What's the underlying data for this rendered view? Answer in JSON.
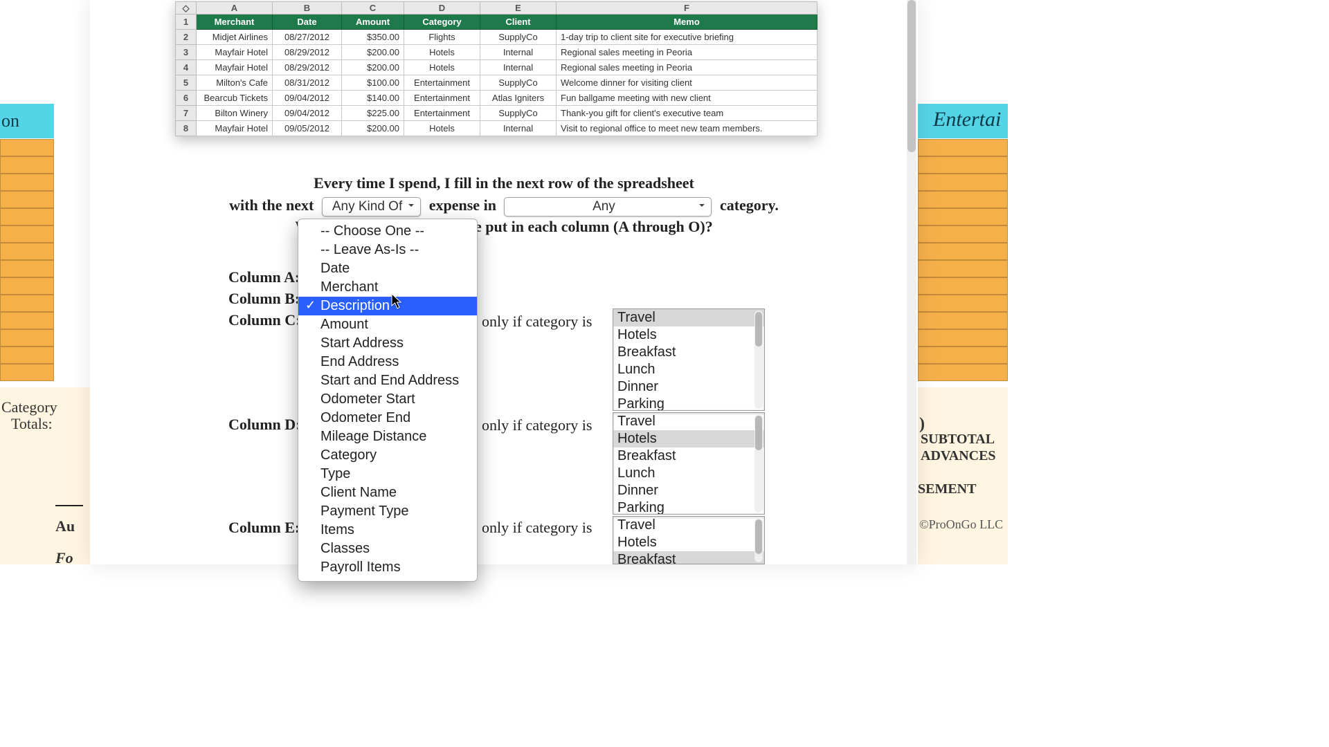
{
  "background": {
    "left_label_cyan": "on",
    "cat_totals_1": "Category",
    "cat_totals_2": "Totals:",
    "au": "Au",
    "fo": "Fo",
    "right_header": "Entertai",
    "subtotal": "SUBTOTAL",
    "advances": "ADVANCES",
    "sement": "SEMENT",
    "copyright": "©ProOnGo LLC"
  },
  "spreadsheet": {
    "col_letters": [
      "A",
      "B",
      "C",
      "D",
      "E",
      "F"
    ],
    "headers": [
      "Merchant",
      "Date",
      "Amount",
      "Category",
      "Client",
      "Memo"
    ],
    "rows": [
      [
        "Midjet Airlines",
        "08/27/2012",
        "$350.00",
        "Flights",
        "SupplyCo",
        "1-day trip to client site for executive briefing"
      ],
      [
        "Mayfair Hotel",
        "08/29/2012",
        "$200.00",
        "Hotels",
        "Internal",
        "Regional sales meeting in Peoria"
      ],
      [
        "Mayfair Hotel",
        "08/29/2012",
        "$200.00",
        "Hotels",
        "Internal",
        "Regional sales meeting in Peoria"
      ],
      [
        "Milton's Cafe",
        "08/31/2012",
        "$100.00",
        "Entertainment",
        "SupplyCo",
        "Welcome dinner for visiting client"
      ],
      [
        "Bearcub Tickets",
        "09/04/2012",
        "$140.00",
        "Entertainment",
        "Atlas Igniters",
        "Fun ballgame meeting with new client"
      ],
      [
        "Bilton Winery",
        "09/04/2012",
        "$225.00",
        "Entertainment",
        "SupplyCo",
        "Thank-you gift for client's executive team"
      ],
      [
        "Mayfair Hotel",
        "09/05/2012",
        "$200.00",
        "Hotels",
        "Internal",
        "Visit to regional office to meet new team members."
      ]
    ]
  },
  "copy": {
    "line1": "Every time I spend, I fill in the next row of the spreadsheet",
    "line2_pre": "with the next",
    "sel_kind": "Any Kind Of",
    "line2_mid": "expense in",
    "sel_cat": "Any",
    "line2_post": "category.",
    "question": "What information should we put in each column (A through O)?",
    "col_a": "Column A:",
    "col_b": "Column B:",
    "col_c": "Column C:",
    "col_d": "Column D:",
    "col_e": "Column E:",
    "only": "only if category is"
  },
  "dropdown": {
    "items": [
      "-- Choose One --",
      "-- Leave As-Is --",
      "Date",
      "Merchant",
      "Description",
      "Amount",
      "Start Address",
      "End Address",
      "Start and End Address",
      "Odometer Start",
      "Odometer End",
      "Mileage Distance",
      "Category",
      "Type",
      "Client Name",
      "Payment Type",
      "Items",
      "Classes",
      "Payroll Items"
    ],
    "highlighted_index": 4
  },
  "listbox": {
    "options": [
      "Travel",
      "Hotels",
      "Breakfast",
      "Lunch",
      "Dinner",
      "Parking"
    ],
    "sel1": [
      0
    ],
    "sel2": [
      1
    ],
    "sel3": [
      2
    ]
  }
}
